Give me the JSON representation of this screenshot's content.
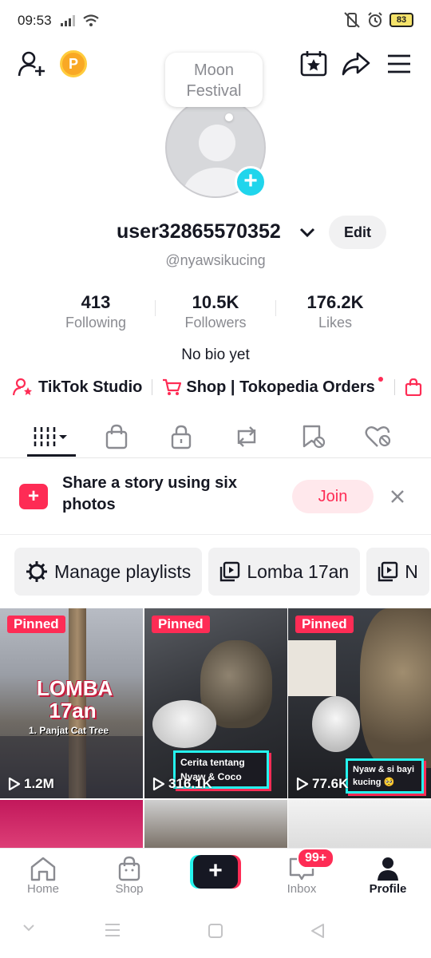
{
  "status_bar": {
    "time": "09:53",
    "battery": "83"
  },
  "profile": {
    "bubble_text": "Moon Festival",
    "username": "user32865570352",
    "handle": "@nyawsikucing",
    "edit_label": "Edit",
    "bio": "No bio yet",
    "coin_letter": "P"
  },
  "stats": [
    {
      "value": "413",
      "label": "Following"
    },
    {
      "value": "10.5K",
      "label": "Followers"
    },
    {
      "value": "176.2K",
      "label": "Likes"
    }
  ],
  "links": {
    "studio": "TikTok Studio",
    "shop": "Shop | Tokopedia Orders"
  },
  "promo": {
    "text": "Share a story using six photos",
    "join_label": "Join"
  },
  "playlists": {
    "manage": "Manage playlists",
    "items": [
      "Lomba 17an",
      "N"
    ]
  },
  "videos": [
    {
      "pinned": "Pinned",
      "views": "1.2M",
      "title": "LOMBA 17an",
      "subtitle": "1. Panjat Cat Tree"
    },
    {
      "pinned": "Pinned",
      "views": "316.1K",
      "caption": "Cerita tentang Nyaw & Coco"
    },
    {
      "pinned": "Pinned",
      "views": "77.6K",
      "caption": "Nyaw & si bayi kucing 🥺"
    }
  ],
  "nav": {
    "home": "Home",
    "shop": "Shop",
    "inbox": "Inbox",
    "inbox_badge": "99+",
    "profile": "Profile"
  },
  "colors": {
    "accent": "#fe2c55",
    "cyan": "#25f4ee",
    "text": "#161823",
    "muted": "#8a8b91"
  }
}
